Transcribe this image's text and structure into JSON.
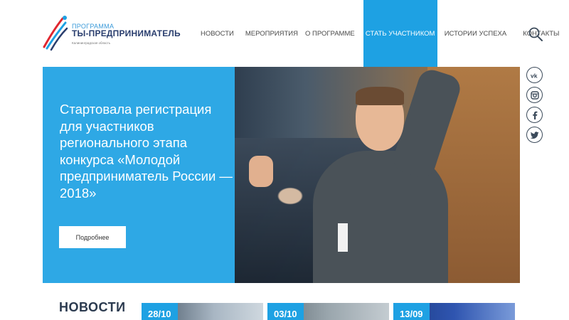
{
  "logo": {
    "small": "ПРОГРАММА",
    "main": "ТЫ-ПРЕДПРИНИМАТЕЛЬ",
    "region": "Калининградская область"
  },
  "nav": {
    "items": [
      {
        "label": "НОВОСТИ"
      },
      {
        "label": "МЕРОПРИЯТИЯ"
      },
      {
        "label": "О ПРОГРАММЕ"
      },
      {
        "label": "СТАТЬ УЧАСТНИКОМ"
      },
      {
        "label": "ИСТОРИИ УСПЕХА"
      },
      {
        "label": "КОНТАКТЫ"
      }
    ],
    "active": "СТАТЬ УЧАСТНИКОМ",
    "search_icon": "search-icon"
  },
  "hero": {
    "title": "Стартовала регистрация для участников регионального этапа конкурса «Молодой предприниматель России — 2018»",
    "button_label": "Подробнее"
  },
  "social": {
    "icons": [
      "vk-icon",
      "instagram-icon",
      "facebook-icon",
      "twitter-icon"
    ]
  },
  "news": {
    "heading": "НОВОСТИ",
    "cards": [
      {
        "date": "28/10"
      },
      {
        "date": "03/10"
      },
      {
        "date": "13/09"
      }
    ]
  },
  "colors": {
    "accent": "#1ea1e3",
    "dark": "#2b3a4f"
  }
}
